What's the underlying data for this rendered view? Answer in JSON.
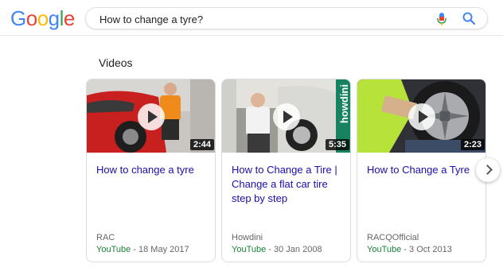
{
  "header": {
    "logo_letters": [
      "G",
      "o",
      "o",
      "g",
      "l",
      "e"
    ],
    "logo_colors": [
      "#4285F4",
      "#EA4335",
      "#FBBC05",
      "#4285F4",
      "#34A853",
      "#EA4335"
    ],
    "search_value": "How to change a tyre?",
    "mic_icon": "mic-icon",
    "search_icon": "search-icon"
  },
  "videos": {
    "section_title": "Videos",
    "items": [
      {
        "title": "How to change a tyre",
        "duration": "2:44",
        "channel": "RAC",
        "source": "YouTube",
        "date": "18 May 2017"
      },
      {
        "title": "How to Change a Tire | Change a flat car tire step by step",
        "duration": "5:35",
        "channel": "Howdini",
        "source": "YouTube",
        "date": "30 Jan 2008",
        "watermark": "howdini"
      },
      {
        "title": "How to Change a Tyre",
        "duration": "2:23",
        "channel": "RACQOfficial",
        "source": "YouTube",
        "date": "3 Oct 2013"
      }
    ],
    "next_icon": "chevron-right-icon"
  },
  "colors": {
    "link": "#1a0dab",
    "source_green": "#188038",
    "meta_gray": "#666666"
  }
}
